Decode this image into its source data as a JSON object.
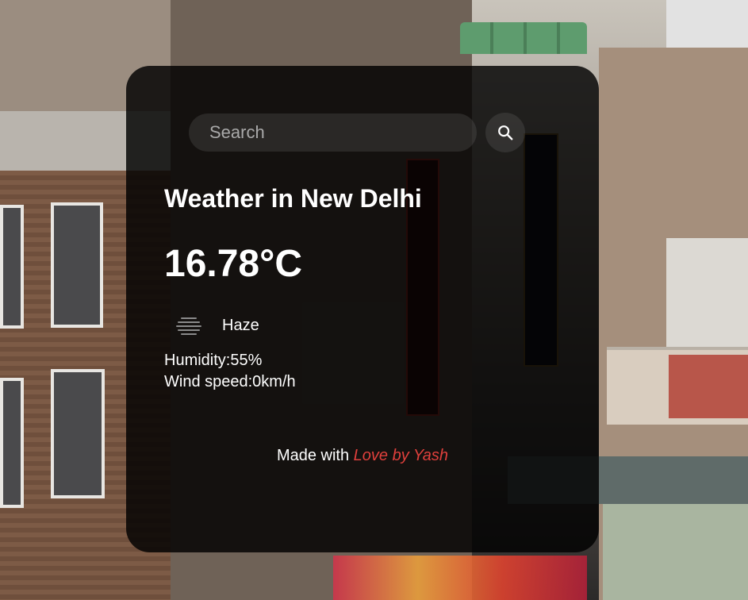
{
  "search": {
    "placeholder": "Search",
    "value": ""
  },
  "weather": {
    "title": "Weather in New Delhi",
    "temperature": "16.78°C",
    "condition": "Haze",
    "condition_icon": "haze-icon",
    "humidity": "Humidity:55%",
    "wind": "Wind speed:0km/h"
  },
  "footer": {
    "prefix": "Made with ",
    "highlight": "Love by Yash",
    "highlight_color": "#e0403c"
  },
  "icons": {
    "search_button": "search-icon"
  }
}
